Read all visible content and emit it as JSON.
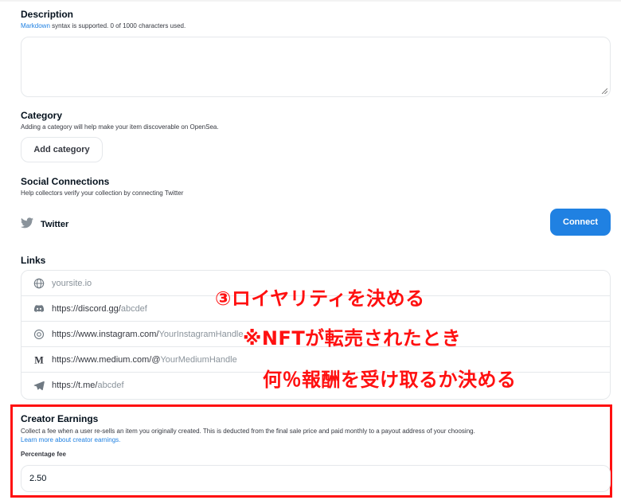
{
  "description": {
    "title": "Description",
    "help_link": "Markdown",
    "help_rest": " syntax is supported. 0 of 1000 characters used.",
    "value": ""
  },
  "category": {
    "title": "Category",
    "subtitle": "Adding a category will help make your item discoverable on OpenSea.",
    "button_label": "Add category"
  },
  "social": {
    "title": "Social Connections",
    "subtitle": "Help collectors verify your collection by connecting Twitter",
    "twitter_label": "Twitter",
    "connect_label": "Connect",
    "accent": "#2081e2"
  },
  "links": {
    "title": "Links",
    "rows": [
      {
        "icon": "globe-icon",
        "prefix": "",
        "placeholder": "yoursite.io"
      },
      {
        "icon": "discord-icon",
        "prefix": "https://discord.gg/",
        "placeholder": "abcdef"
      },
      {
        "icon": "instagram-icon",
        "prefix": "https://www.instagram.com/",
        "placeholder": "YourInstagramHandle"
      },
      {
        "icon": "medium-icon",
        "prefix": "https://www.medium.com/@",
        "placeholder": "YourMediumHandle"
      },
      {
        "icon": "telegram-icon",
        "prefix": "https://t.me/",
        "placeholder": "abcdef"
      }
    ]
  },
  "annotation": {
    "line1": "③ロイヤリティを決める",
    "line2": "※NFTが転売されたとき",
    "line3": "何％報酬を受け取るか決める",
    "color": "#ff1010"
  },
  "creator_earnings": {
    "title": "Creator Earnings",
    "description": "Collect a fee when a user re-sells an item you originally created. This is deducted from the final sale price and paid monthly to a payout address of your choosing.",
    "learn_more": "Learn more about creator earnings.",
    "fee_label": "Percentage fee",
    "fee_value": "2.50"
  }
}
